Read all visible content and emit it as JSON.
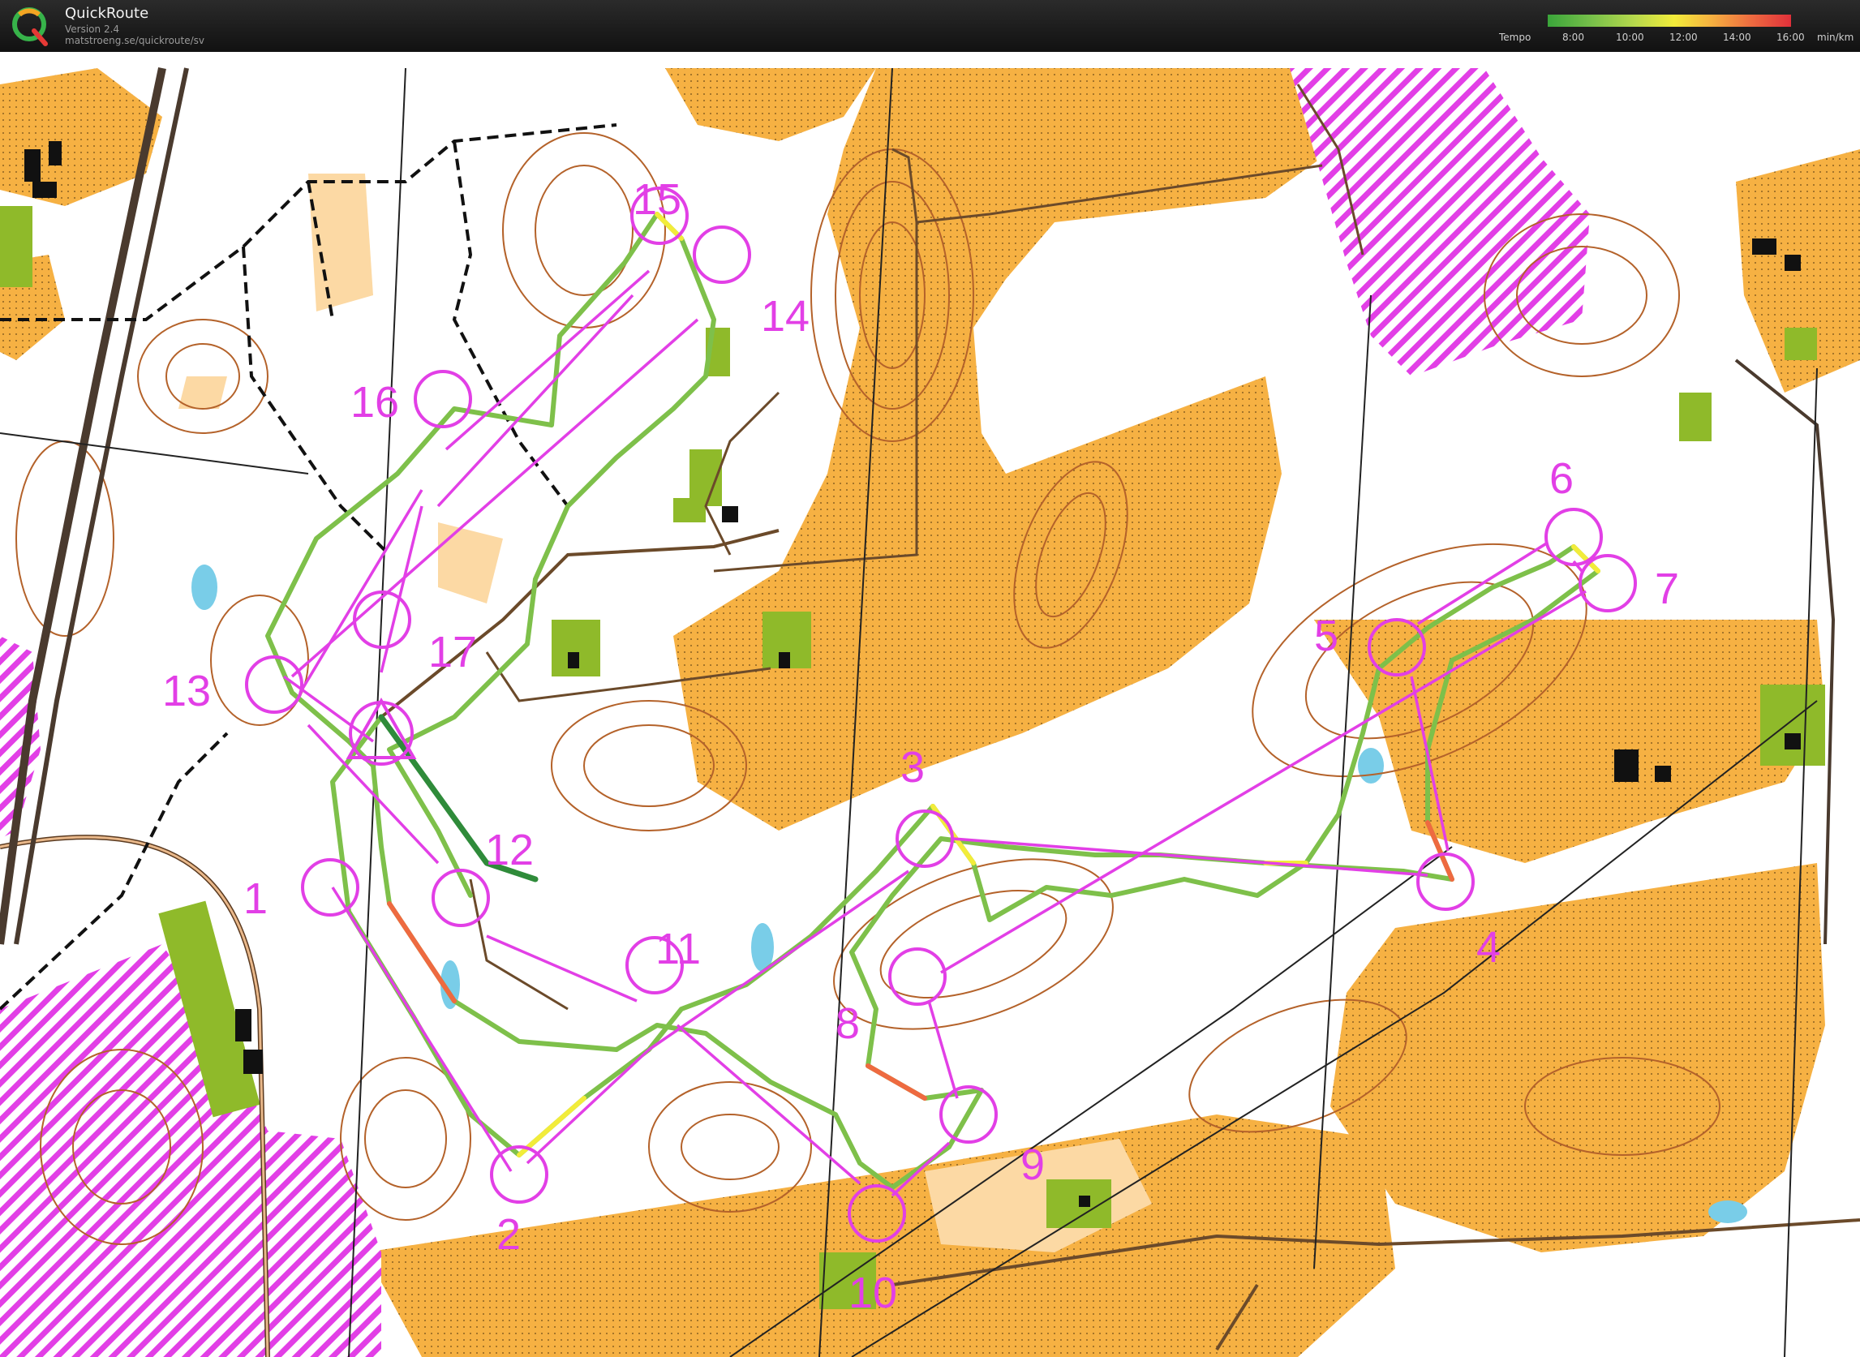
{
  "app": {
    "title": "QuickRoute",
    "version": "Version 2.4",
    "url": "matstroeng.se/quickroute/sv"
  },
  "tempo_legend": {
    "label": "Tempo",
    "ticks": [
      "8:00",
      "10:00",
      "12:00",
      "14:00",
      "16:00"
    ],
    "unit": "min/km",
    "colors": [
      "#3aa53a",
      "#b8d94c",
      "#f2ec3a",
      "#f6b640",
      "#e0303a"
    ]
  },
  "map": {
    "colors": {
      "open": "#f6b143",
      "semi_open": "#fcd9a4",
      "forest": "#ffffff",
      "contour": "#b4622a",
      "green": "#8fba2a",
      "restricted": "#e23fe6",
      "course": "#e23fe6",
      "water": "#79cde8"
    },
    "controls": [
      {
        "label": "1"
      },
      {
        "label": "2"
      },
      {
        "label": "3"
      },
      {
        "label": "4"
      },
      {
        "label": "5"
      },
      {
        "label": "6"
      },
      {
        "label": "7"
      },
      {
        "label": "8"
      },
      {
        "label": "9"
      },
      {
        "label": "10"
      },
      {
        "label": "11"
      },
      {
        "label": "12"
      },
      {
        "label": "13"
      },
      {
        "label": "14"
      },
      {
        "label": "15"
      },
      {
        "label": "16"
      },
      {
        "label": "17"
      }
    ]
  }
}
